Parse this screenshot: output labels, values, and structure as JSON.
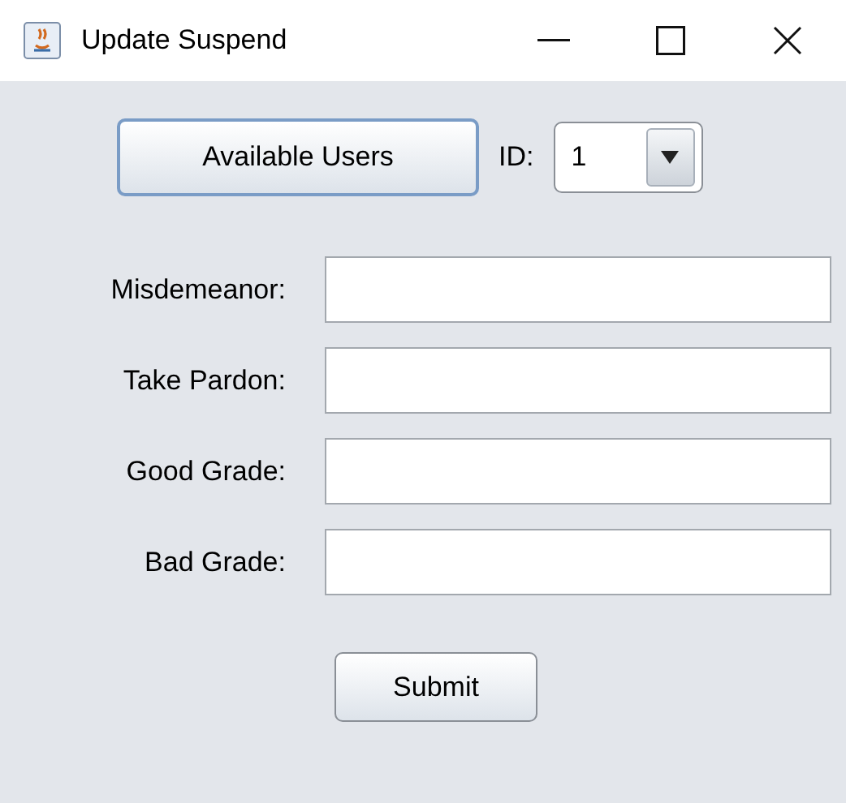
{
  "window": {
    "title": "Update Suspend"
  },
  "top_row": {
    "button": "Available Users",
    "id_label": "ID:",
    "id_value": "1"
  },
  "fields": [
    {
      "label": "Misdemeanor:"
    },
    {
      "label": "Take Pardon:"
    },
    {
      "label": "Good Grade:"
    },
    {
      "label": "Bad Grade:"
    }
  ],
  "submit": "Submit"
}
